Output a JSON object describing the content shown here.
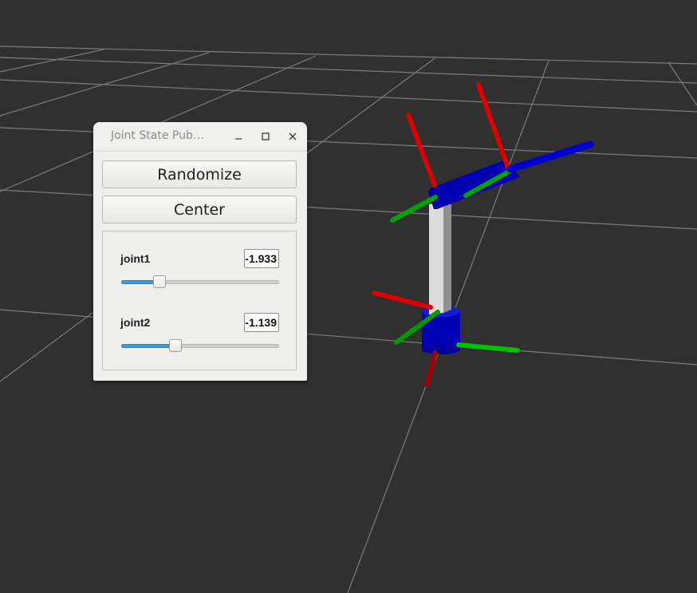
{
  "window": {
    "title": "Joint State Pub…",
    "minimize_icon": "minimize-icon",
    "maximize_icon": "maximize-icon",
    "close_icon": "close-icon"
  },
  "buttons": {
    "randomize": "Randomize",
    "center": "Center"
  },
  "joints": [
    {
      "name": "joint1",
      "value": "-1.933",
      "slider_fraction": 0.22
    },
    {
      "name": "joint2",
      "value": "-1.139",
      "slider_fraction": 0.33
    }
  ],
  "viewport": {
    "background_color": "#303030",
    "grid_color": "#a0a0a0",
    "x_axis_color": "#e00000",
    "y_axis_color": "#00c000",
    "z_axis_color": "#0000cc",
    "link_color": "#0000b8",
    "upper_link_color": "#d6d6d6"
  },
  "colors": {
    "slider_fill": "#3d9be0",
    "window_bg": "#efefee"
  }
}
